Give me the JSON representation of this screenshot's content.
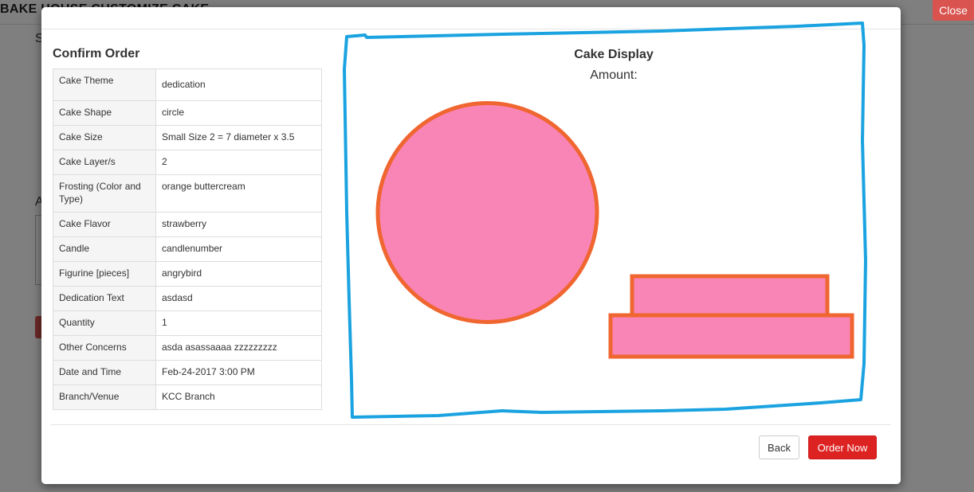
{
  "background": {
    "title": "BAKE HOUSE CUSTOMIZE CAKE",
    "close_label": "Close",
    "letter_s": "S",
    "letter_a": "A",
    "accent_color": "#d9534f"
  },
  "modal": {
    "order_title": "Confirm Order",
    "order_rows": [
      {
        "label": "Cake Theme",
        "value": "dedication"
      },
      {
        "label": "Cake Shape",
        "value": "circle"
      },
      {
        "label": "Cake Size",
        "value": "Small Size 2 = 7 diameter x 3.5"
      },
      {
        "label": "Cake Layer/s",
        "value": "2"
      },
      {
        "label": "Frosting (Color and Type)",
        "value": "orange buttercream"
      },
      {
        "label": "Cake Flavor",
        "value": "strawberry"
      },
      {
        "label": "Candle",
        "value": "candlenumber"
      },
      {
        "label": "Figurine [pieces]",
        "value": "angrybird"
      },
      {
        "label": "Dedication Text",
        "value": "asdasd"
      },
      {
        "label": "Quantity",
        "value": "1"
      },
      {
        "label": "Other Concerns",
        "value": "asda asassaaaa zzzzzzzzz"
      },
      {
        "label": "Date and Time",
        "value": "Feb-24-2017 3:00 PM"
      },
      {
        "label": "Branch/Venue",
        "value": "KCC Branch"
      }
    ],
    "display_title": "Cake Display",
    "amount_label": "Amount:",
    "cake_fill_color": "#f984b6",
    "cake_stroke_color": "#f06630",
    "annotation_color": "#1aa3e0",
    "back_label": "Back",
    "order_now_label": "Order Now",
    "order_now_color": "#dd2222"
  }
}
